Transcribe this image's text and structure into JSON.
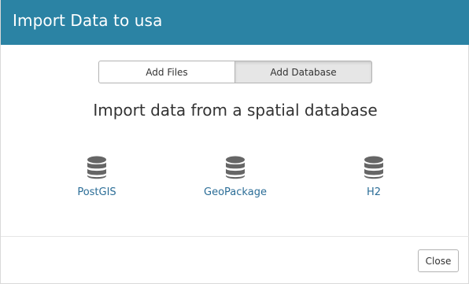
{
  "dialog": {
    "title": "Import Data to usa"
  },
  "tabs": [
    {
      "label": "Add Files",
      "active": false
    },
    {
      "label": "Add Database",
      "active": true
    }
  ],
  "main": {
    "subtitle": "Import data from a spatial database"
  },
  "sources": [
    {
      "label": "PostGIS",
      "icon": "database-icon"
    },
    {
      "label": "GeoPackage",
      "icon": "database-icon"
    },
    {
      "label": "H2",
      "icon": "database-icon"
    }
  ],
  "footer": {
    "close_label": "Close"
  },
  "colors": {
    "header_bg": "#2b83a4",
    "link": "#2b6d97",
    "icon": "#666666"
  }
}
